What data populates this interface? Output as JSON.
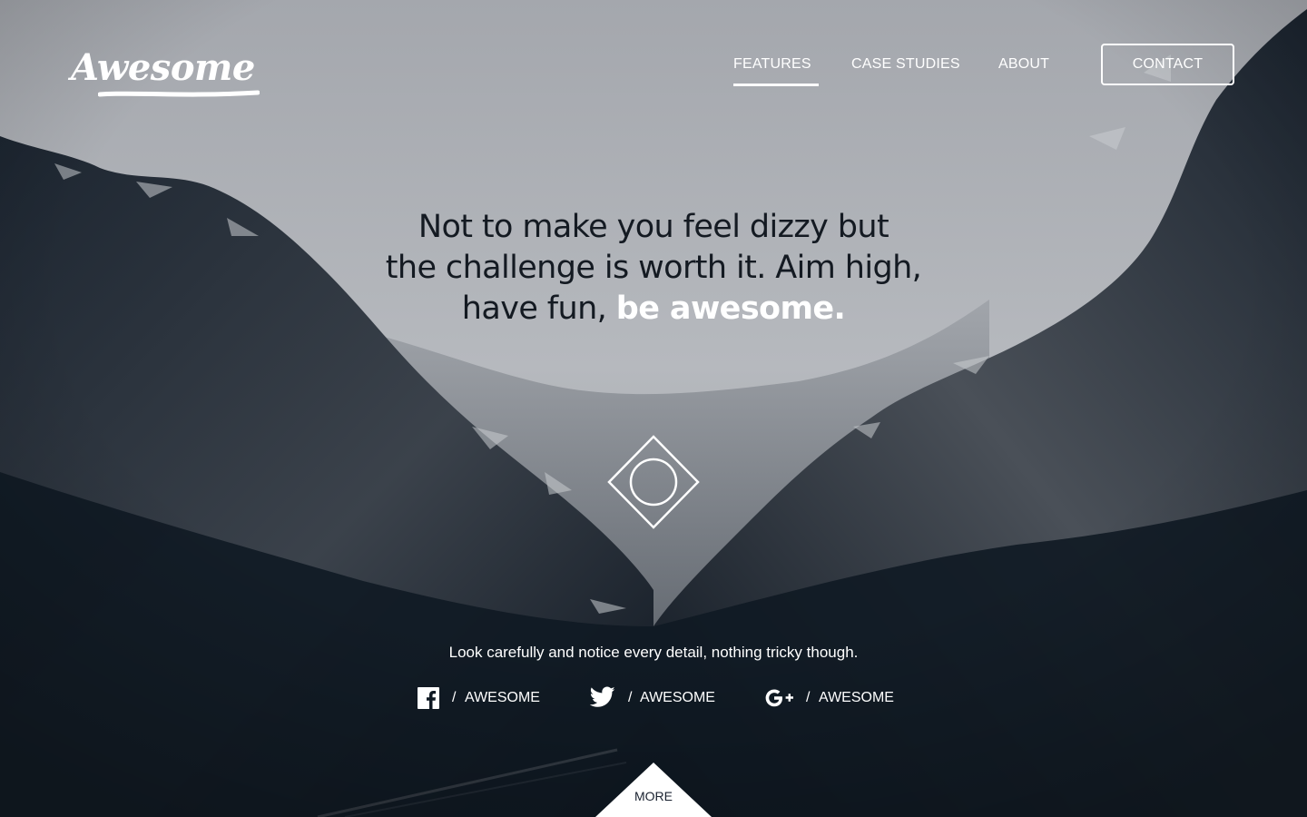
{
  "header": {
    "logo_text": "Awesome",
    "nav": [
      {
        "label": "FEATURES",
        "active": true
      },
      {
        "label": "CASE STUDIES",
        "active": false
      },
      {
        "label": "ABOUT",
        "active": false
      }
    ],
    "contact_label": "CONTACT"
  },
  "hero": {
    "line1": "Not to make you feel dizzy but",
    "line2": "the challenge is worth it. Aim high,",
    "line3_prefix": "have fun,",
    "line3_emphasis": "be awesome.",
    "tagline": "Look carefully and notice every detail, nothing tricky though."
  },
  "social": [
    {
      "icon": "facebook-icon",
      "separator": "/",
      "label": "AWESOME"
    },
    {
      "icon": "twitter-icon",
      "separator": "/",
      "label": "AWESOME"
    },
    {
      "icon": "google-plus-icon",
      "separator": "/",
      "label": "AWESOME"
    }
  ],
  "more_label": "MORE",
  "colors": {
    "text_light": "#ffffff",
    "text_dark": "#141a22",
    "sky": "#aeb1b6",
    "mountain_dark": "#0d1722"
  }
}
